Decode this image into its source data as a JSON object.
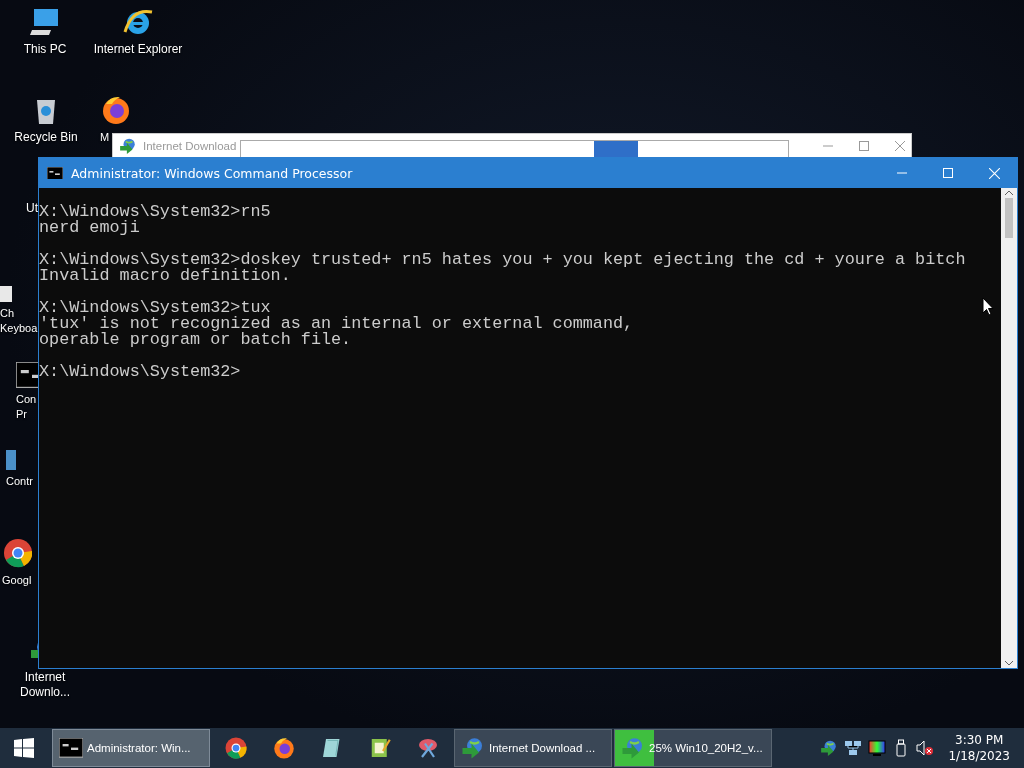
{
  "desktop_icons": [
    {
      "label": "This PC",
      "kind": "pc"
    },
    {
      "label": "Internet Explorer",
      "kind": "ie"
    },
    {
      "label": "Recycle Bin",
      "kind": "bin"
    },
    {
      "label": "M",
      "kind": "firefox"
    },
    {
      "label": "Ut",
      "kind": "none"
    },
    {
      "label": "Ch\nKeyboa",
      "kind": "keyboard"
    },
    {
      "label": "Con\nPr",
      "kind": "console"
    },
    {
      "label": "Contr",
      "kind": "panel"
    },
    {
      "label": "Googl",
      "kind": "chrome"
    },
    {
      "label": "Internet\nDownlo...",
      "kind": "idm"
    }
  ],
  "background_window": {
    "title": "Internet Download"
  },
  "console_window": {
    "title": "Administrator: Windows Command Processor",
    "blocks": [
      [
        "X:\\Windows\\System32>rn5",
        "nerd emoji"
      ],
      [
        "X:\\Windows\\System32>doskey trusted+ rn5 hates you + you kept ejecting the cd + youre a bitch",
        "Invalid macro definition."
      ],
      [
        "X:\\Windows\\System32>tux",
        "'tux' is not recognized as an internal or external command,",
        "operable program or batch file."
      ],
      [
        "X:\\Windows\\System32>"
      ]
    ]
  },
  "taskbar": {
    "items": [
      {
        "kind": "task",
        "label": "Administrator: Win...",
        "selected": true
      },
      {
        "kind": "pin"
      },
      {
        "kind": "pin"
      },
      {
        "kind": "pin"
      },
      {
        "kind": "pin"
      },
      {
        "kind": "pin"
      },
      {
        "kind": "task",
        "label": "Internet Download ...",
        "selected": false
      },
      {
        "kind": "task",
        "label": "25% Win10_20H2_v...",
        "selected": false,
        "level": 0.25
      }
    ],
    "clock": {
      "time": "3:30 PM",
      "date": "1/18/2023"
    }
  }
}
